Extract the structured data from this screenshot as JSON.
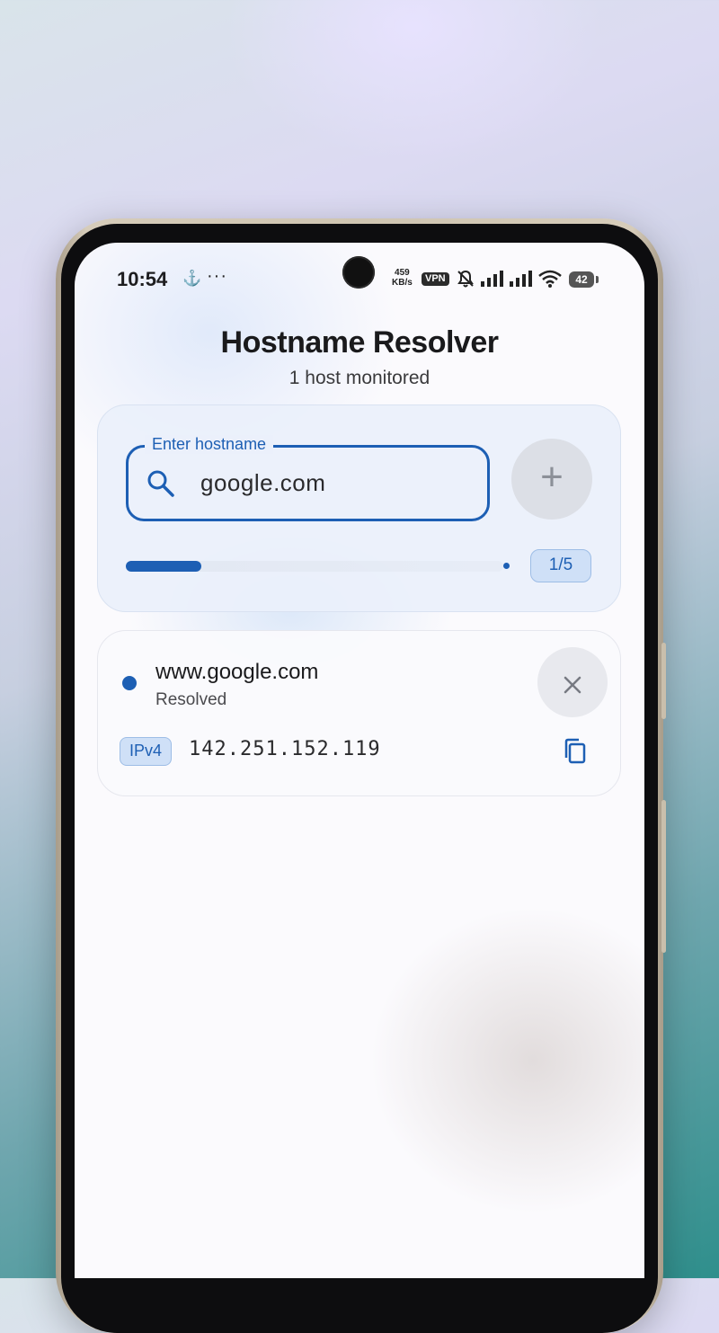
{
  "status_bar": {
    "time": "10:54",
    "net_speed_value": "459",
    "net_speed_unit": "KB/s",
    "vpn": "VPN",
    "battery": "42"
  },
  "app": {
    "title": "Hostname Resolver",
    "subtitle": "1 host monitored"
  },
  "input": {
    "label": "Enter hostname",
    "value": "google.com",
    "add_label": "+",
    "progress_fraction": 0.2,
    "count": "1/5"
  },
  "hosts": [
    {
      "name": "www.google.com",
      "status": "Resolved",
      "ip_type": "IPv4",
      "ip": "142.251.152.119"
    }
  ],
  "colors": {
    "accent": "#1d5fb4",
    "badge_bg": "#cfe0f7"
  },
  "icons": [
    "anchor-icon",
    "more-dots-icon",
    "bell-off-icon",
    "signal-icon",
    "wifi-icon",
    "search-icon",
    "plus-icon",
    "close-icon",
    "copy-icon"
  ]
}
